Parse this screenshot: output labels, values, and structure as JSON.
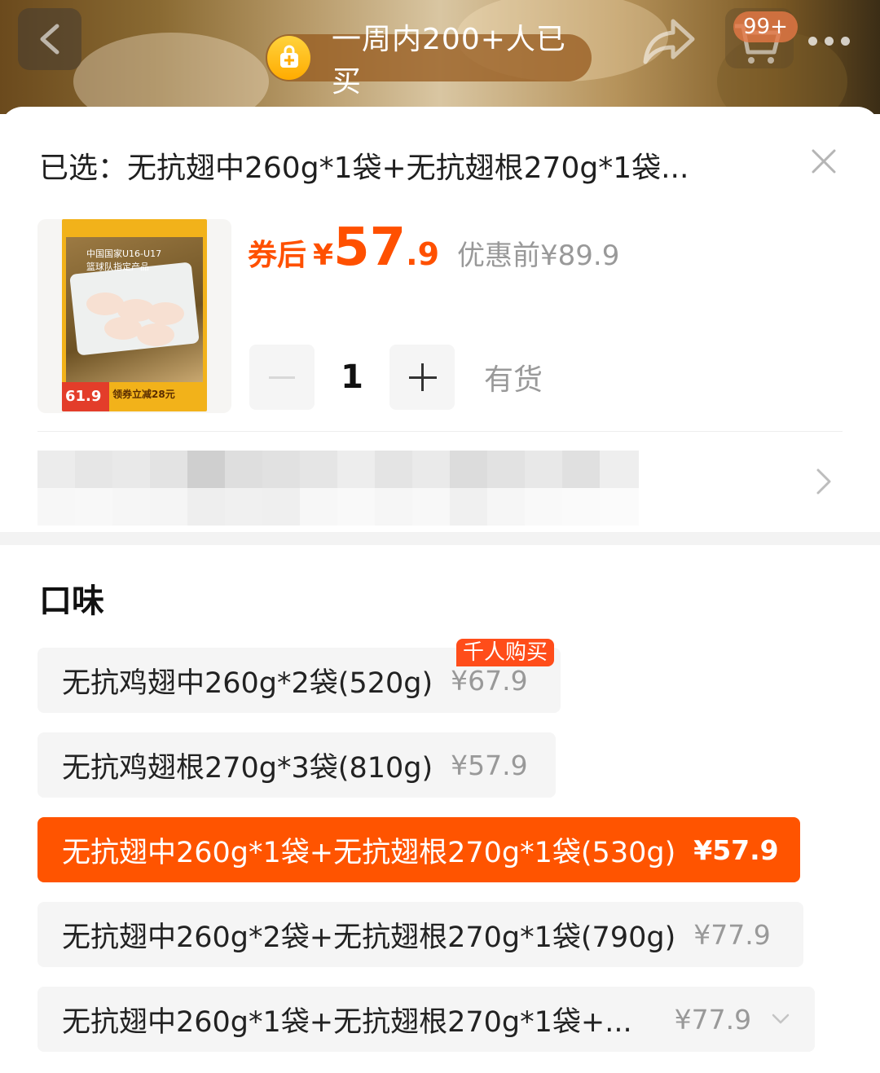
{
  "header": {
    "buyers_text": "一周内200+人已买",
    "cart_badge": "99+"
  },
  "sheet": {
    "selected_text": "已选：无抗翅中260g*1袋+无抗翅根270g*1袋...",
    "product_image": {
      "header_line1": "中国国家U16-U17",
      "header_line2": "篮球队指定产品",
      "price_tag": "61.9",
      "coupon_tag": "领券立减28元"
    },
    "price": {
      "coupon_label": "券后",
      "currency": "¥",
      "integer": "57",
      "decimal": ".9",
      "original": "优惠前¥89.9"
    },
    "quantity": {
      "value": "1",
      "stock_text": "有货"
    },
    "flavor": {
      "title": "口味",
      "hot_badge": "千人购买",
      "options": [
        {
          "name": "无抗鸡翅中260g*2袋(520g)",
          "price": "¥67.9"
        },
        {
          "name": "无抗鸡翅根270g*3袋(810g)",
          "price": "¥57.9"
        },
        {
          "name": "无抗翅中260g*1袋+无抗翅根270g*1袋(530g)",
          "price": "¥57.9"
        },
        {
          "name": "无抗翅中260g*2袋+无抗翅根270g*1袋(790g)",
          "price": "¥77.9"
        },
        {
          "name": "无抗翅中260g*1袋+无抗翅根270g*1袋+...",
          "price": "¥77.9"
        }
      ],
      "selected_index": 2
    }
  },
  "colors": {
    "accent": "#ff5400",
    "price_red": "#ff5000",
    "muted": "#999999"
  },
  "icons": [
    "back-arrow-icon",
    "shopping-bag-icon",
    "share-icon",
    "cart-icon",
    "more-dots-icon",
    "close-icon",
    "chevron-right-icon",
    "chevron-down-icon"
  ]
}
